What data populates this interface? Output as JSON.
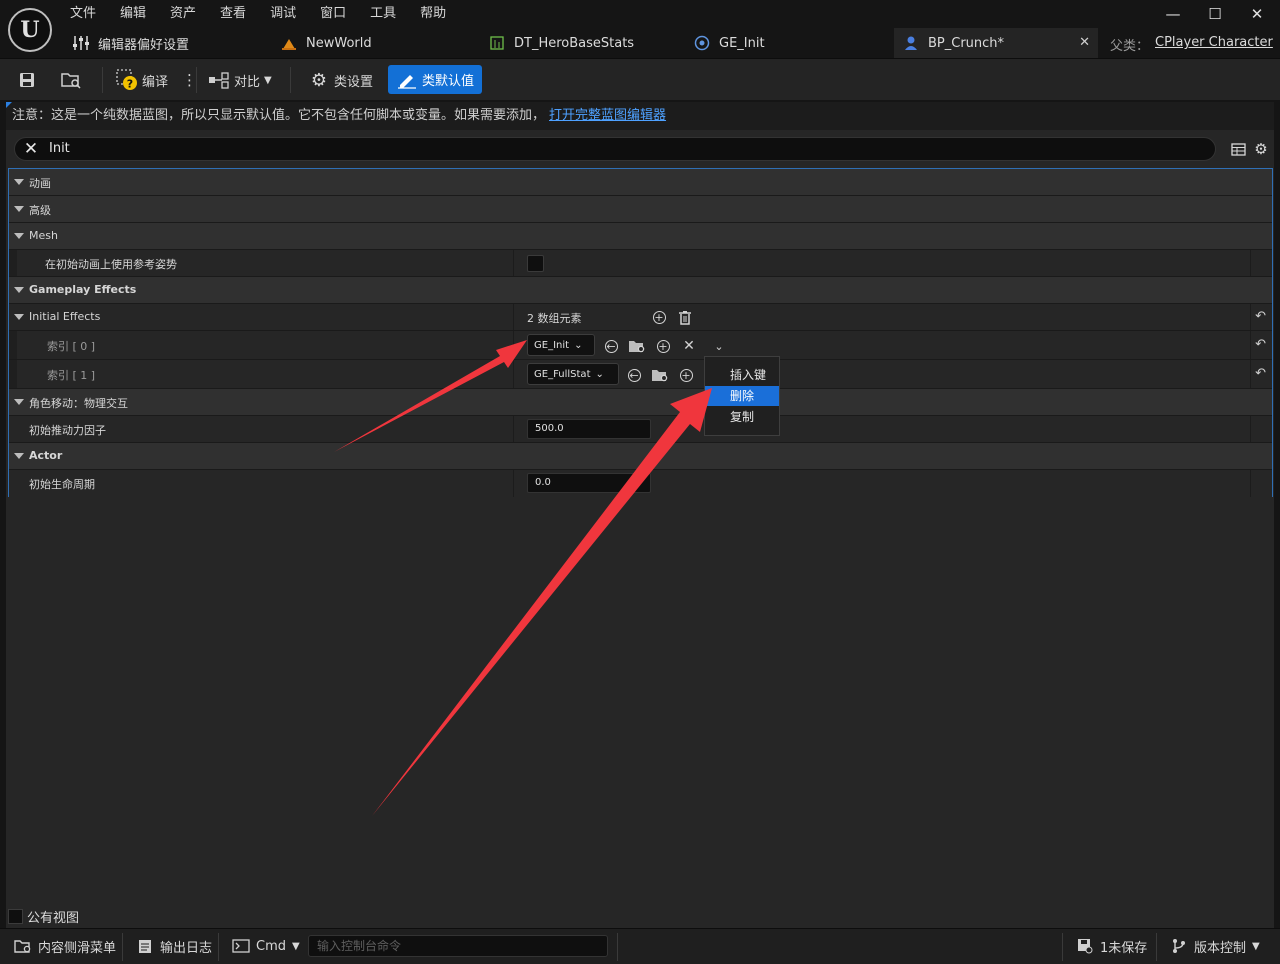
{
  "menu": [
    "文件",
    "编辑",
    "资产",
    "查看",
    "调试",
    "窗口",
    "工具",
    "帮助"
  ],
  "tabs": {
    "editor_prefs": "编辑器偏好设置",
    "newworld": "NewWorld",
    "datatable": "DT_HeroBaseStats",
    "ge_init": "GE_Init",
    "bp": "BP_Crunch*"
  },
  "parent": {
    "label": "父类：",
    "value": "CPlayer Character"
  },
  "toolbar": {
    "compile": "编译",
    "diff": "对比",
    "class_settings": "类设置",
    "class_defaults": "类默认值"
  },
  "notice": {
    "text": "注意：这是一个纯数据蓝图，所以只显示默认值。它不包含任何脚本或变量。如果需要添加，",
    "link": "打开完整蓝图编辑器"
  },
  "search": {
    "value": "Init"
  },
  "details": {
    "cat_animation": "动画",
    "cat_advanced": "高级",
    "cat_mesh": "Mesh",
    "prop_ref_pose": "在初始动画上使用参考姿势",
    "cat_gameplay_effects": "Gameplay Effects",
    "prop_initial_effects": "Initial Effects",
    "array_count": "2 数组元素",
    "index0_label": "索引 [ 0 ]",
    "index0_value": "GE_Init",
    "index1_label": "索引 [ 1 ]",
    "index1_value": "GE_FullStat",
    "cat_movement": "角色移动：物理交互",
    "prop_push_factor": "初始推动力因子",
    "push_factor_value": "500.0",
    "cat_actor": "Actor",
    "prop_lifespan": "初始生命周期",
    "lifespan_value": "0.0"
  },
  "context_menu": {
    "insert": "插入键",
    "delete": "删除",
    "duplicate": "复制"
  },
  "public_view": "公有视图",
  "statusbar": {
    "content_drawer": "内容侧滑菜单",
    "output_log": "输出日志",
    "cmd": "Cmd",
    "console_placeholder": "输入控制台命令",
    "unsaved": "1未保存",
    "source_control": "版本控制"
  },
  "colors": {
    "accent": "#1370d6",
    "annotation_arrow": "#f0363d",
    "details_border": "#2f6fb5"
  }
}
